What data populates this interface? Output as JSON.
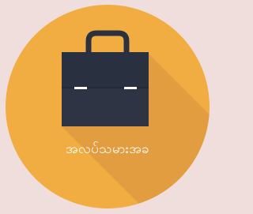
{
  "app": {
    "label": "အလပ်သမားအခ",
    "icon": "briefcase-icon"
  },
  "colors": {
    "background": "#f0dedd",
    "circle": "#f2ad42",
    "shadow": "#d9953a",
    "briefcase_body": "#2e3440",
    "briefcase_top": "#2b3141",
    "latch": "#ffffff",
    "label": "#ffffff"
  }
}
